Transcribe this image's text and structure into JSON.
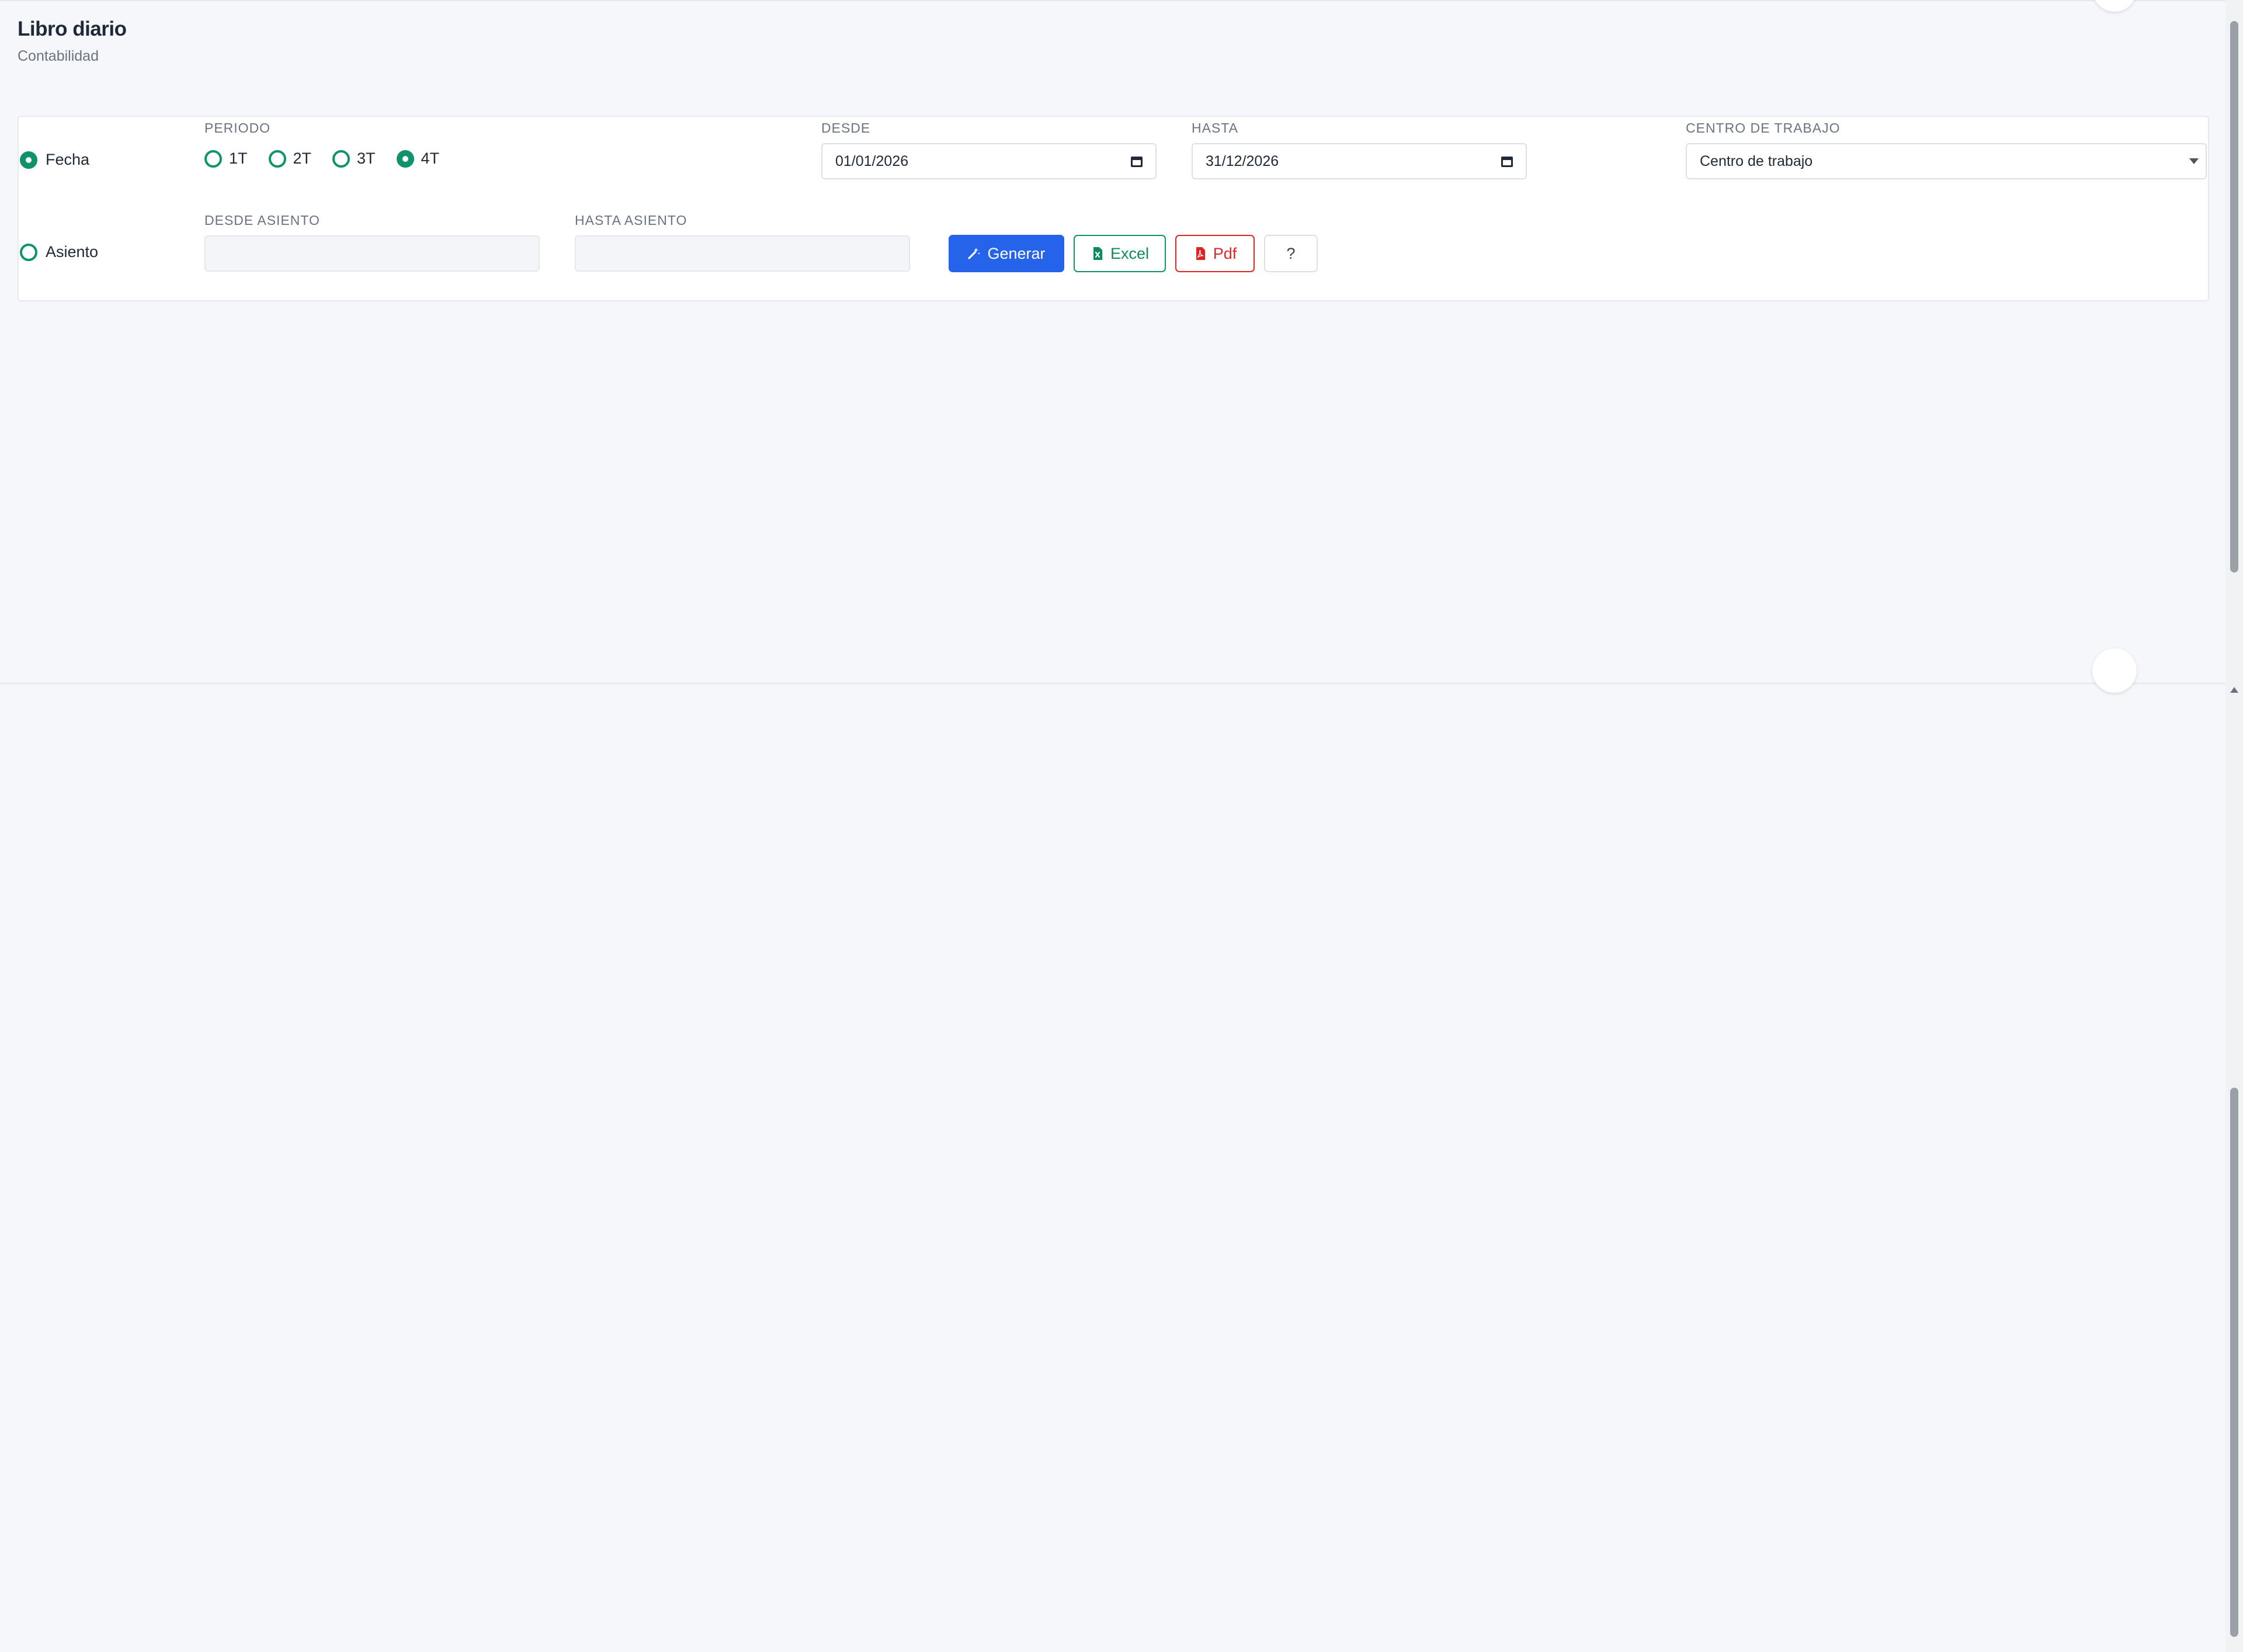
{
  "header": {
    "title": "Libro diario",
    "subtitle": "Contabilidad"
  },
  "filters": {
    "mode_fecha_label": "Fecha",
    "mode_asiento_label": "Asiento",
    "mode_selected": "Fecha",
    "periodo_label": "PERIODO",
    "periods": [
      {
        "label": "1T",
        "checked": false
      },
      {
        "label": "2T",
        "checked": false
      },
      {
        "label": "3T",
        "checked": false
      },
      {
        "label": "4T",
        "checked": true
      }
    ],
    "desde_label": "DESDE",
    "desde_value": "01/01/2026",
    "hasta_label": "HASTA",
    "hasta_value": "31/12/2026",
    "centro_label": "CENTRO DE TRABAJO",
    "centro_value": "Centro de trabajo",
    "desde_asiento_label": "DESDE ASIENTO",
    "desde_asiento_value": "",
    "hasta_asiento_label": "HASTA ASIENTO",
    "hasta_asiento_value": ""
  },
  "actions": {
    "generar_label": "Generar",
    "excel_label": "Excel",
    "pdf_label": "Pdf",
    "help_label": "?"
  },
  "colors": {
    "accent_green": "#10936a",
    "primary_blue": "#2563eb",
    "danger_red": "#dc2626",
    "background": "#f6f7fa"
  },
  "icons": {
    "generar": "magic-wand-icon",
    "excel": "file-excel-icon",
    "pdf": "file-pdf-icon",
    "date": "calendar-icon",
    "select": "chevron-down-icon"
  }
}
